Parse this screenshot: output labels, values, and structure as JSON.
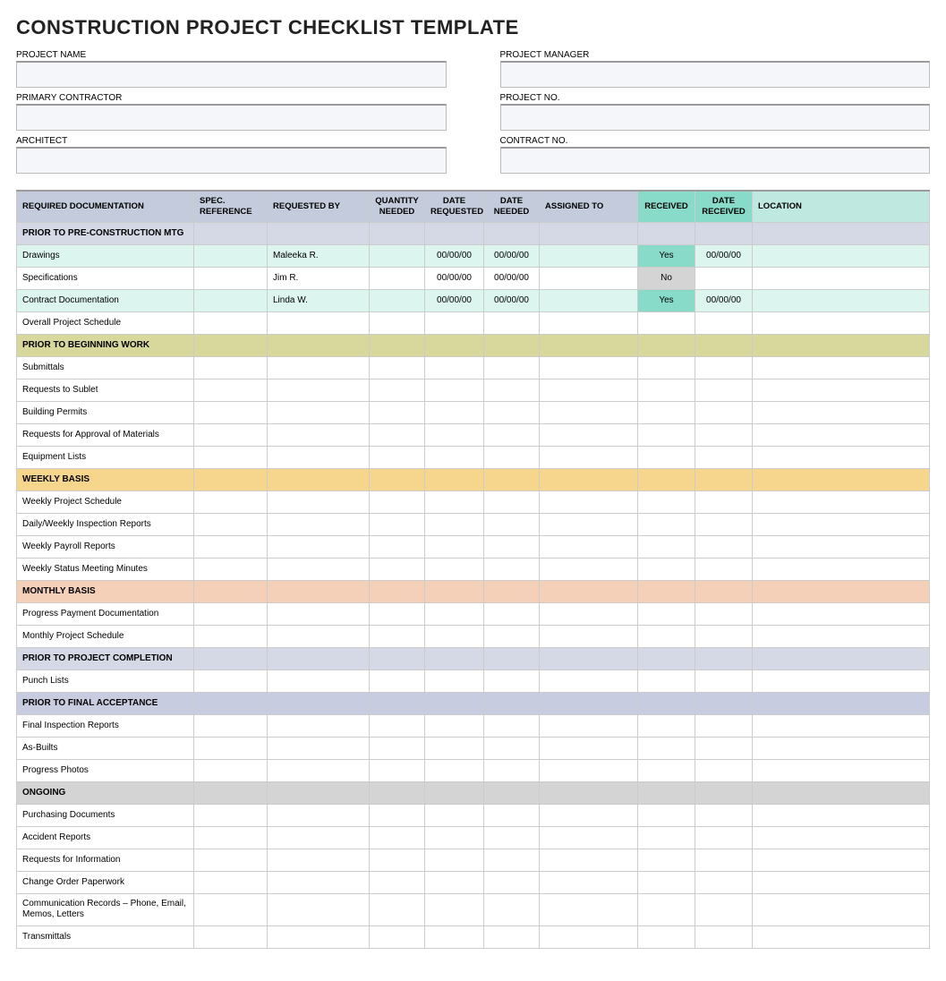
{
  "title": "CONSTRUCTION PROJECT CHECKLIST TEMPLATE",
  "meta": {
    "project_name": {
      "label": "PROJECT NAME",
      "value": ""
    },
    "project_manager": {
      "label": "PROJECT MANAGER",
      "value": ""
    },
    "primary_contractor": {
      "label": "PRIMARY CONTRACTOR",
      "value": ""
    },
    "project_no": {
      "label": "PROJECT NO.",
      "value": ""
    },
    "architect": {
      "label": "ARCHITECT",
      "value": ""
    },
    "contract_no": {
      "label": "CONTRACT NO.",
      "value": ""
    }
  },
  "headers": {
    "doc": "REQUIRED DOCUMENTATION",
    "spec": "SPEC. REFERENCE",
    "req_by": "REQUESTED BY",
    "qty": "QUANTITY NEEDED",
    "date_req": "DATE REQUESTED",
    "date_need": "DATE NEEDED",
    "assigned": "ASSIGNED TO",
    "received": "RECEIVED",
    "date_recv": "DATE RECEIVED",
    "location": "LOCATION"
  },
  "rows": [
    {
      "type": "section",
      "style": "grayblue",
      "label": "PRIOR TO PRE-CONSTRUCTION MTG"
    },
    {
      "type": "data",
      "style": "mint",
      "doc": "Drawings",
      "spec": "",
      "req_by": "Maleeka R.",
      "qty": "",
      "date_req": "00/00/00",
      "date_need": "00/00/00",
      "assigned": "",
      "received": "Yes",
      "date_recv": "00/00/00",
      "location": ""
    },
    {
      "type": "data",
      "style": "",
      "doc": "Specifications",
      "spec": "",
      "req_by": "Jim R.",
      "qty": "",
      "date_req": "00/00/00",
      "date_need": "00/00/00",
      "assigned": "",
      "received": "No",
      "date_recv": "",
      "location": ""
    },
    {
      "type": "data",
      "style": "mint",
      "doc": "Contract Documentation",
      "spec": "",
      "req_by": "Linda W.",
      "qty": "",
      "date_req": "00/00/00",
      "date_need": "00/00/00",
      "assigned": "",
      "received": "Yes",
      "date_recv": "00/00/00",
      "location": ""
    },
    {
      "type": "data",
      "style": "",
      "doc": "Overall Project Schedule",
      "spec": "",
      "req_by": "",
      "qty": "",
      "date_req": "",
      "date_need": "",
      "assigned": "",
      "received": "",
      "date_recv": "",
      "location": ""
    },
    {
      "type": "section",
      "style": "olive",
      "label": "PRIOR TO BEGINNING WORK"
    },
    {
      "type": "data",
      "style": "",
      "doc": "Submittals"
    },
    {
      "type": "data",
      "style": "",
      "doc": "Requests to Sublet"
    },
    {
      "type": "data",
      "style": "",
      "doc": "Building Permits"
    },
    {
      "type": "data",
      "style": "",
      "doc": "Requests for Approval of Materials"
    },
    {
      "type": "data",
      "style": "",
      "doc": "Equipment Lists"
    },
    {
      "type": "section",
      "style": "gold",
      "label": "WEEKLY BASIS"
    },
    {
      "type": "data",
      "style": "",
      "doc": "Weekly Project Schedule"
    },
    {
      "type": "data",
      "style": "",
      "doc": "Daily/Weekly Inspection Reports"
    },
    {
      "type": "data",
      "style": "",
      "doc": "Weekly Payroll Reports"
    },
    {
      "type": "data",
      "style": "",
      "doc": "Weekly Status Meeting Minutes"
    },
    {
      "type": "section",
      "style": "peach",
      "label": "MONTHLY BASIS"
    },
    {
      "type": "data",
      "style": "",
      "doc": "Progress Payment Documentation"
    },
    {
      "type": "data",
      "style": "",
      "doc": "Monthly Project Schedule"
    },
    {
      "type": "section",
      "style": "grayblue",
      "label": "PRIOR TO PROJECT COMPLETION"
    },
    {
      "type": "data",
      "style": "",
      "doc": "Punch Lists"
    },
    {
      "type": "section",
      "style": "lav",
      "label": "PRIOR TO FINAL ACCEPTANCE"
    },
    {
      "type": "data",
      "style": "",
      "doc": "Final Inspection Reports"
    },
    {
      "type": "data",
      "style": "",
      "doc": "As-Builts"
    },
    {
      "type": "data",
      "style": "",
      "doc": "Progress Photos"
    },
    {
      "type": "section",
      "style": "gray",
      "label": "ONGOING"
    },
    {
      "type": "data",
      "style": "",
      "doc": "Purchasing Documents"
    },
    {
      "type": "data",
      "style": "",
      "doc": "Accident Reports"
    },
    {
      "type": "data",
      "style": "",
      "doc": "Requests for Information"
    },
    {
      "type": "data",
      "style": "",
      "doc": "Change Order Paperwork"
    },
    {
      "type": "data",
      "style": "",
      "doc": "Communication Records – Phone, Email, Memos, Letters"
    },
    {
      "type": "data",
      "style": "",
      "doc": "Transmittals"
    }
  ]
}
